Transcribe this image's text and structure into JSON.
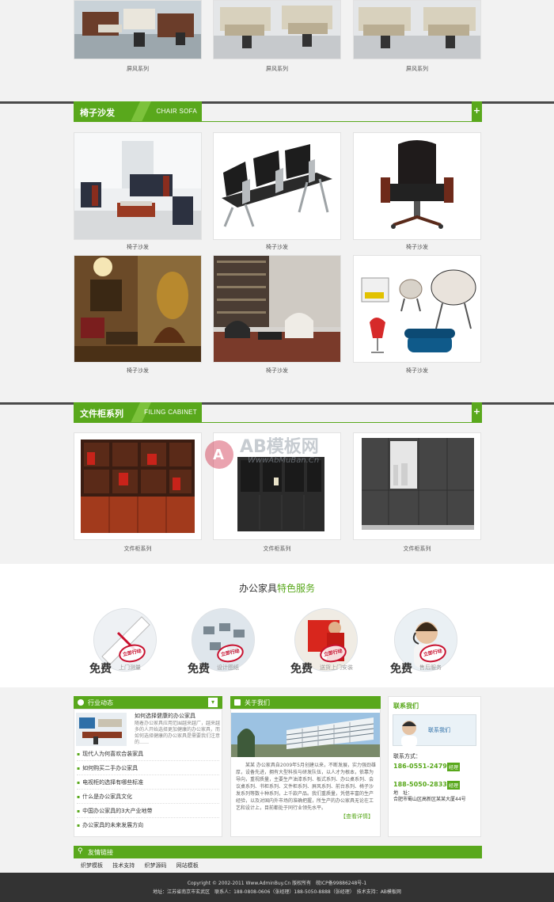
{
  "sections": {
    "screen": {
      "captions": [
        "屏风系列",
        "屏风系列",
        "屏风系列"
      ]
    },
    "chairs": {
      "title_cn": "椅子沙发",
      "title_en": "CHAIR SOFA",
      "captions": [
        "椅子沙发",
        "椅子沙发",
        "椅子沙发",
        "椅子沙发",
        "椅子沙发",
        "椅子沙发"
      ]
    },
    "cabinets": {
      "title_cn": "文件柜系列",
      "title_en": "FILING CABINET",
      "captions": [
        "文件柜系列",
        "文件柜系列",
        "文件柜系列"
      ]
    },
    "more_symbol": "+"
  },
  "watermark": {
    "brand": "AB模板网",
    "url": "WwwAbMuBan.Cn"
  },
  "services": {
    "title_plain": "办公家具",
    "title_highlight": "特色服务",
    "stamp_text": "立即行动",
    "items": [
      {
        "free": "免费",
        "desc": "上门测量"
      },
      {
        "free": "免费",
        "desc": "设计图纸"
      },
      {
        "free": "免费",
        "desc": "送货上门安装"
      },
      {
        "free": "免费",
        "desc": "售后服务"
      }
    ]
  },
  "news": {
    "title": "行业动态",
    "more_symbol": "▾",
    "featured_title": "如何选择健康的办公家具",
    "featured_text": "随着办公家具应用范围越来越广，越来越多的人开始选择更加健康的办公家具，而如何选择健康的办公家具是需要我们注意的……",
    "items": [
      "现代人为何喜欢合装家具",
      "如何购买二手办公家具",
      "电视柜的选择有哪些标准",
      "什么是办公家具文化",
      "中国办公家具的3大产业地带",
      "办公家具的未来发展方向"
    ]
  },
  "about": {
    "title": "关于我们",
    "text": "某某 办公家具自2009年5月创建以来，不断发展，实力强劲雄厚，设备先进，拥有大型科技与研发队伍，以人才为根本，依靠为导向，重视质量，主要生产油漆系列、板式系列、办公桌系列、会议桌系列、书柜系列、文件柜系列、屏风系列、前台系列、椅子沙发系列等数十种系列，上千款产品。我们重质量，凭借丰富的生产经验，以及对国内外市场的准确把握，所生产的办公家具无论在工艺和设计上，目前都处于同行业领先水平。",
    "more": "【查看详情】"
  },
  "contact": {
    "title": "联系我们",
    "banner_text": "联系我们",
    "label": "联系方式：",
    "phone1": "186-0551-2479",
    "phone1_tag": "经理",
    "phone2": "188-5050-2833",
    "phone2_tag": "经理",
    "address_label": "地　址：",
    "address": "合肥市蜀山区高新区某某大厦44号"
  },
  "friends": {
    "title": "友情链接",
    "links": [
      "织梦模板",
      "技术支持",
      "织梦源码",
      "网站模板"
    ]
  },
  "footer": {
    "line1": "Copyright © 2002-2011 Www.AdminBuy.Cn 版权所有　皖ICP备99886248号-1",
    "line2": "地址：江苏省南京市玄武区　联系人：188-0808-0606（张经理）188-5050-8888（张经理）　技术支持：AB模板网"
  },
  "colors": {
    "accent": "#59a81c",
    "footer_bg": "#333333",
    "stamp_red": "#c8102e"
  }
}
